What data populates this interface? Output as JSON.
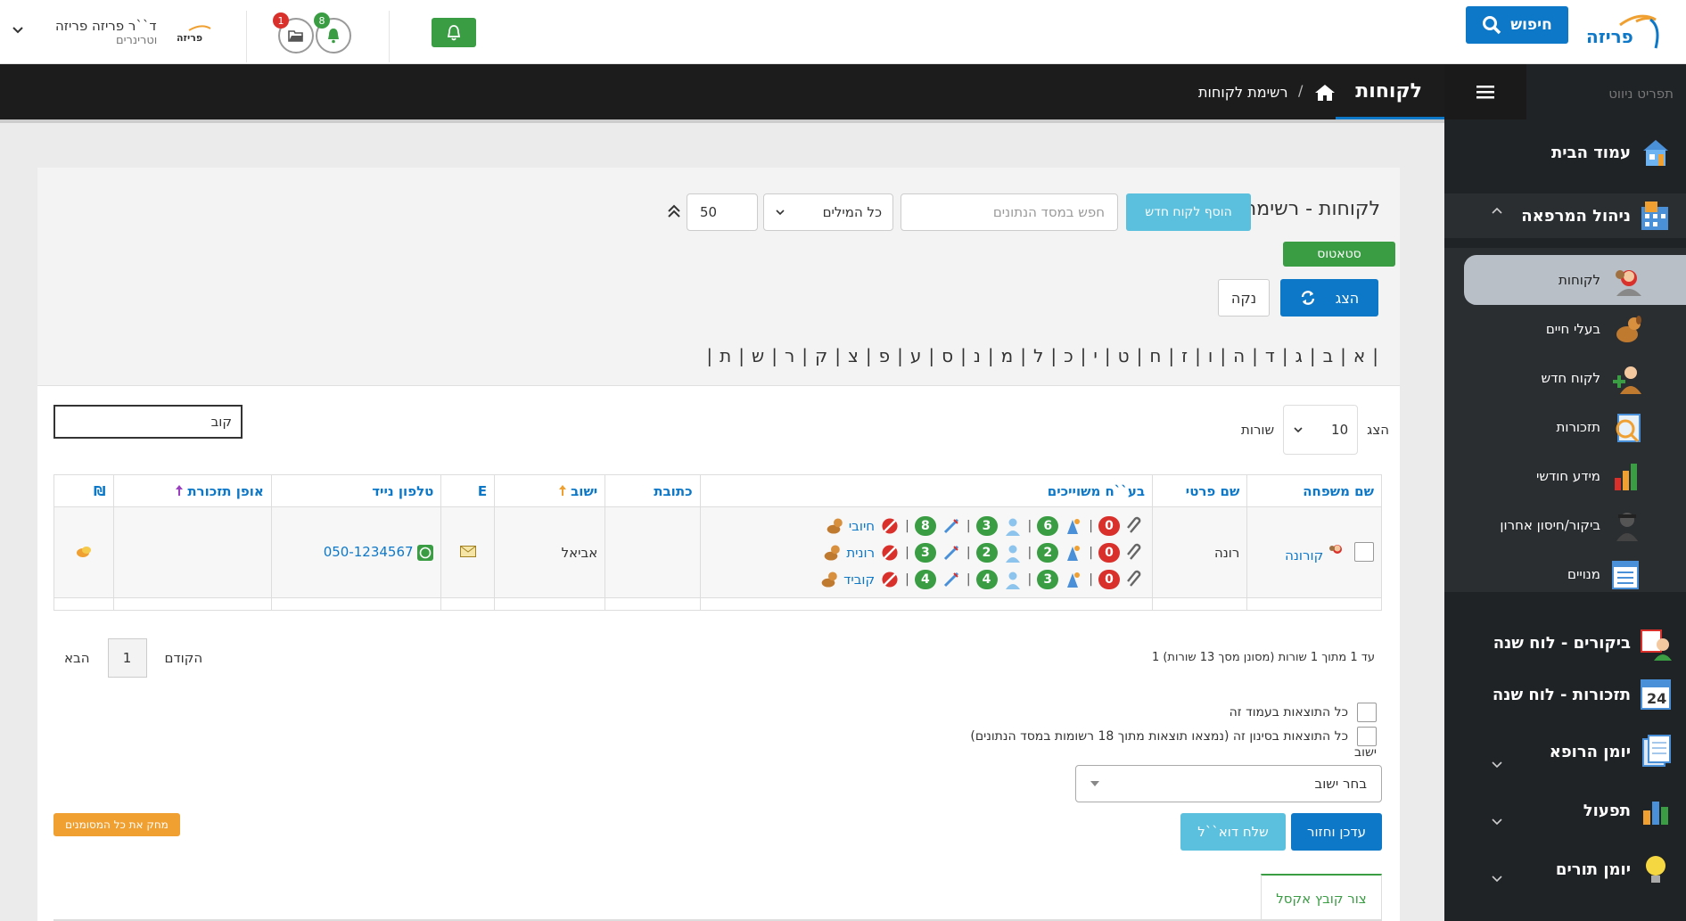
{
  "topbar": {
    "search_label": "חיפוש",
    "badge_notifications": "8",
    "badge_files": "1",
    "user_name": "ד``ר פריזה פריזה",
    "user_role": "וטרינרים",
    "brand_color": "#0e78c8"
  },
  "breadcrumb": {
    "page_title": "לקוחות",
    "separator": "/",
    "current": "רשימת לקוחות"
  },
  "sidebar": {
    "caption": "תפריט ניווט",
    "main_items": [
      {
        "label": "עמוד הבית",
        "icon": "home-icon"
      },
      {
        "label": "ניהול המרפאה",
        "icon": "clinic-icon"
      },
      {
        "label": "ביקורים - לוח שנה",
        "icon": "visits-calendar-icon"
      },
      {
        "label": "תזכורות - לוח שנה",
        "icon": "reminders-calendar-icon"
      },
      {
        "label": "יומן הרופא",
        "icon": "doctor-diary-icon"
      },
      {
        "label": "תפעול",
        "icon": "operations-icon"
      },
      {
        "label": "יומן תורים",
        "icon": "appointments-icon"
      }
    ],
    "sub_items": [
      {
        "label": "לקוחות",
        "icon": "customers-icon"
      },
      {
        "label": "בעלי חיים",
        "icon": "animals-icon"
      },
      {
        "label": "לקוח חדש",
        "icon": "new-customer-icon"
      },
      {
        "label": "תזכורות",
        "icon": "reminders-icon"
      },
      {
        "label": "מידע חודשי",
        "icon": "monthly-info-icon"
      },
      {
        "label": "ביקור/חיסון אחרון",
        "icon": "last-visit-icon"
      },
      {
        "label": "מנויים",
        "icon": "subscriptions-icon"
      }
    ]
  },
  "list": {
    "title": "לקוחות - רשימה",
    "add_button": "הוסף לקוח חדש",
    "search_placeholder": "חפש במסד הנתונים",
    "words_select": "כל המילים",
    "limit_value": "50",
    "status_button": "סטאטוס",
    "show_button": "הצג",
    "clear_button": "נקה",
    "alphabet": [
      "א",
      "ב",
      "ג",
      "ד",
      "ה",
      "ו",
      "ז",
      "ח",
      "ט",
      "י",
      "כ",
      "ל",
      "מ",
      "נ",
      "ס",
      "ע",
      "פ",
      "צ",
      "ק",
      "ר",
      "ש",
      "ת"
    ]
  },
  "table": {
    "show_label": "הצג",
    "rows_label": "שורות",
    "page_length": "10",
    "filter_value": "קוב",
    "columns": [
      "שם משפחה",
      "שם פרטי",
      "בע``ח משוייכים",
      "כתובת",
      "ישוב",
      "E",
      "טלפון נייד",
      "אופן תזכורת",
      "₪"
    ],
    "rows": [
      {
        "last_name": "קורונה",
        "first_name": "רונה",
        "address": "",
        "city": "אביאל",
        "phone": "050-1234567",
        "reminder_method": "",
        "animals": [
          {
            "name": "חיובי",
            "stats": [
              "8",
              "3",
              "6",
              "0"
            ]
          },
          {
            "name": "רונית",
            "stats": [
              "3",
              "2",
              "2",
              "0"
            ]
          },
          {
            "name": "קוביד",
            "stats": [
              "4",
              "4",
              "3",
              "0"
            ]
          }
        ]
      }
    ],
    "info": "1 עד 1 מתוך 1 שורות (מסונן מסך 13 שורות)",
    "prev": "הקודם",
    "page": "1",
    "next": "הבא"
  },
  "bulk": {
    "all_page": "כל התוצאות בעמוד זה",
    "all_filter": "כל התוצאות בסינון זה (נמצאו תוצאות מתוך 18 רשומות במסד הנתונים)",
    "yishuv_label": "ישוב",
    "yishuv_select": "בחר ישוב",
    "update_button": "עדכן וחזור",
    "send_button": "שלח דוא``ל",
    "delete_button": "מחק את כל המסומנים",
    "excel_tab": "צור קובץ אקסל"
  }
}
